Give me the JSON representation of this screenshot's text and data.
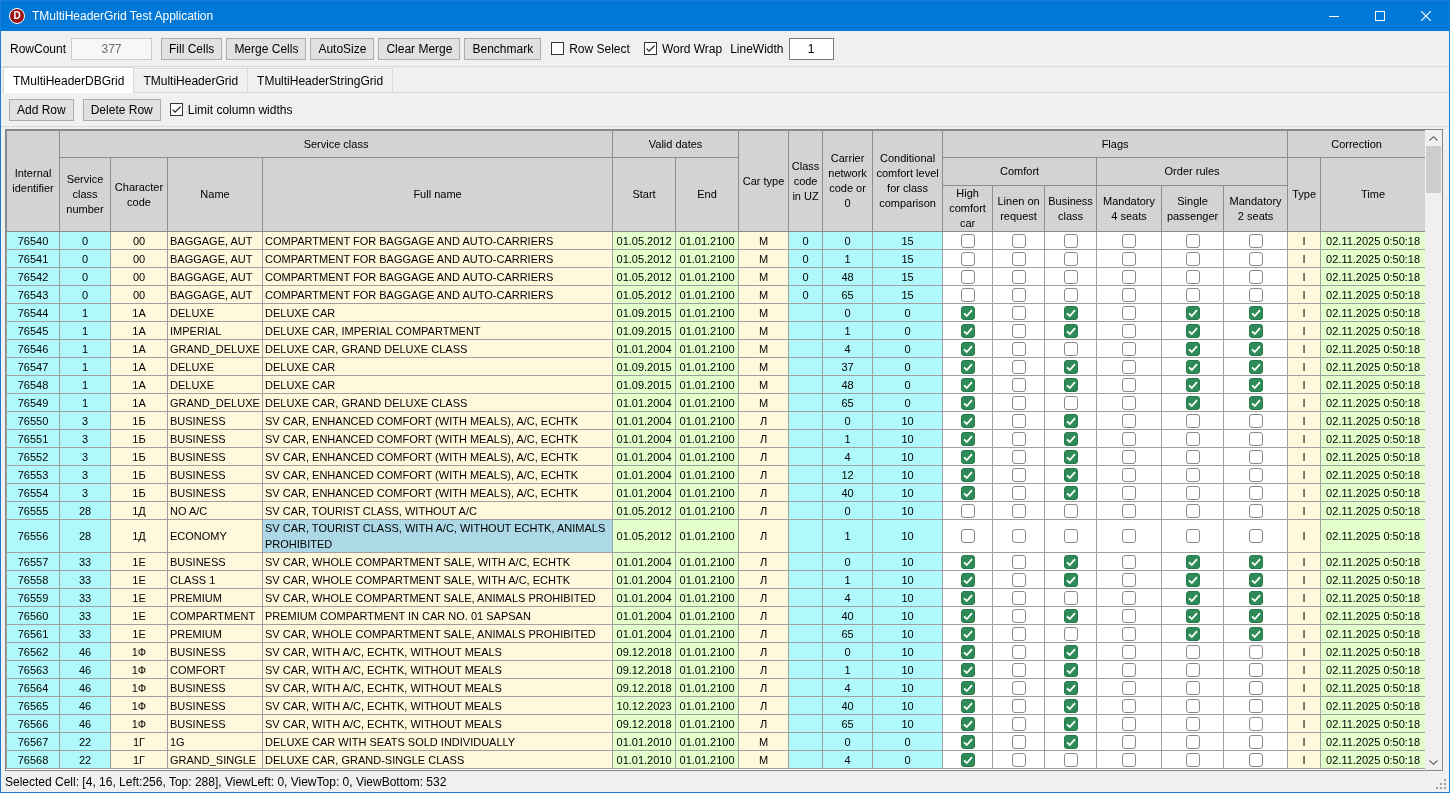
{
  "window": {
    "logo": "D",
    "title": "TMultiHeaderGrid Test Application"
  },
  "toolbar": {
    "row_count": {
      "label": "RowCount",
      "value": "377",
      "disabled": true
    },
    "buttons": [
      "Fill Cells",
      "Merge Cells",
      "AutoSize",
      "Clear Merge",
      "Benchmark"
    ],
    "checkboxes": [
      {
        "label": "Row Select",
        "checked": false
      },
      {
        "label": "Word Wrap",
        "checked": true
      }
    ],
    "line_width": {
      "label": "LineWidth",
      "value": "1"
    }
  },
  "tabs": [
    {
      "label": "TMultiHeaderDBGrid",
      "selected": true
    },
    {
      "label": "TMultiHeaderGrid",
      "selected": false
    },
    {
      "label": "TMultiHeaderStringGrid",
      "selected": false
    }
  ],
  "grid_toolbar": {
    "buttons": [
      "Add Row",
      "Delete Row"
    ],
    "checkbox": {
      "label": "Limit column widths",
      "checked": true
    }
  },
  "grid": {
    "header": [
      {
        "label": "Internal identifier",
        "kind": "number",
        "selected": false
      },
      {
        "label": "Service class",
        "children": [
          {
            "label": "Service class number",
            "kind": "number",
            "selected": false
          },
          {
            "label": "Character code",
            "kind": "code",
            "selected": false
          },
          {
            "label": "Name",
            "kind": "text",
            "selected": false
          },
          {
            "label": "Full name",
            "kind": "text",
            "selected": true
          }
        ]
      },
      {
        "label": "Valid dates",
        "children": [
          {
            "label": "Start",
            "kind": "date",
            "selected": false
          },
          {
            "label": "End",
            "kind": "date",
            "selected": false
          }
        ]
      },
      {
        "label": "Car type",
        "kind": "code",
        "selected": false
      },
      {
        "label": "Class code in UZ",
        "kind": "number",
        "selected": false
      },
      {
        "label": "Carrier network code or 0",
        "kind": "number",
        "selected": false
      },
      {
        "label": "Conditional comfort level for class comparison",
        "kind": "number",
        "selected": false
      },
      {
        "label": "Flags",
        "children": [
          {
            "label": "Comfort",
            "children": [
              {
                "label": "High comfort car",
                "kind": "flag",
                "selected": false
              },
              {
                "label": "Linen on request",
                "kind": "flag",
                "selected": false
              },
              {
                "label": "Business class",
                "kind": "flag",
                "selected": false
              }
            ]
          },
          {
            "label": "Order rules",
            "children": [
              {
                "label": "Mandatory 4 seats",
                "kind": "flag",
                "selected": false
              },
              {
                "label": "Single passenger",
                "kind": "flag",
                "selected": false
              },
              {
                "label": "Mandatory 2 seats",
                "kind": "flag",
                "selected": false
              }
            ]
          }
        ]
      },
      {
        "label": "Correction",
        "children": [
          {
            "label": "Type",
            "kind": "code",
            "selected": false
          },
          {
            "label": "Time",
            "kind": "date",
            "selected": false
          }
        ]
      }
    ],
    "rows": [
      {
        "selected": false,
        "cells": [
          "76540",
          "0",
          "00",
          "BAGGAGE, AUT",
          "COMPARTMENT FOR BAGGAGE AND AUTO-CARRIERS",
          "01.05.2012",
          "01.01.2100",
          "М",
          "0",
          "0",
          "15",
          "I",
          "02.11.2025 0:50:18"
        ],
        "checked": [
          false,
          false,
          false,
          false,
          false,
          false
        ]
      },
      {
        "selected": false,
        "cells": [
          "76541",
          "0",
          "00",
          "BAGGAGE, AUT",
          "COMPARTMENT FOR BAGGAGE AND AUTO-CARRIERS",
          "01.05.2012",
          "01.01.2100",
          "М",
          "0",
          "1",
          "15",
          "I",
          "02.11.2025 0:50:18"
        ],
        "checked": [
          false,
          false,
          false,
          false,
          false,
          false
        ]
      },
      {
        "selected": false,
        "cells": [
          "76542",
          "0",
          "00",
          "BAGGAGE, AUT",
          "COMPARTMENT FOR BAGGAGE AND AUTO-CARRIERS",
          "01.05.2012",
          "01.01.2100",
          "М",
          "0",
          "48",
          "15",
          "I",
          "02.11.2025 0:50:18"
        ],
        "checked": [
          false,
          false,
          false,
          false,
          false,
          false
        ]
      },
      {
        "selected": false,
        "cells": [
          "76543",
          "0",
          "00",
          "BAGGAGE, AUT",
          "COMPARTMENT FOR BAGGAGE AND AUTO-CARRIERS",
          "01.05.2012",
          "01.01.2100",
          "М",
          "0",
          "65",
          "15",
          "I",
          "02.11.2025 0:50:18"
        ],
        "checked": [
          false,
          false,
          false,
          false,
          false,
          false
        ]
      },
      {
        "selected": false,
        "cells": [
          "76544",
          "1",
          "1А",
          "DELUXE",
          "DELUXE CAR",
          "01.09.2015",
          "01.01.2100",
          "М",
          null,
          "0",
          "0",
          "I",
          "02.11.2025 0:50:18"
        ],
        "checked": [
          true,
          false,
          true,
          false,
          true,
          true
        ]
      },
      {
        "selected": false,
        "cells": [
          "76545",
          "1",
          "1А",
          "IMPERIAL",
          "DELUXE CAR, IMPERIAL COMPARTMENT",
          "01.09.2015",
          "01.01.2100",
          "М",
          null,
          "1",
          "0",
          "I",
          "02.11.2025 0:50:18"
        ],
        "checked": [
          true,
          false,
          true,
          false,
          true,
          true
        ]
      },
      {
        "selected": false,
        "cells": [
          "76546",
          "1",
          "1А",
          "GRAND_DELUXE",
          "DELUXE CAR, GRAND DELUXE CLASS",
          "01.01.2004",
          "01.01.2100",
          "М",
          null,
          "4",
          "0",
          "I",
          "02.11.2025 0:50:18"
        ],
        "checked": [
          true,
          false,
          false,
          false,
          true,
          true
        ]
      },
      {
        "selected": false,
        "cells": [
          "76547",
          "1",
          "1А",
          "DELUXE",
          "DELUXE CAR",
          "01.09.2015",
          "01.01.2100",
          "М",
          null,
          "37",
          "0",
          "I",
          "02.11.2025 0:50:18"
        ],
        "checked": [
          true,
          false,
          true,
          false,
          true,
          true
        ]
      },
      {
        "selected": false,
        "cells": [
          "76548",
          "1",
          "1А",
          "DELUXE",
          "DELUXE CAR",
          "01.09.2015",
          "01.01.2100",
          "М",
          null,
          "48",
          "0",
          "I",
          "02.11.2025 0:50:18"
        ],
        "checked": [
          true,
          false,
          true,
          false,
          true,
          true
        ]
      },
      {
        "selected": false,
        "cells": [
          "76549",
          "1",
          "1А",
          "GRAND_DELUXE",
          "DELUXE CAR, GRAND DELUXE CLASS",
          "01.01.2004",
          "01.01.2100",
          "М",
          null,
          "65",
          "0",
          "I",
          "02.11.2025 0:50:18"
        ],
        "checked": [
          true,
          false,
          false,
          false,
          true,
          true
        ]
      },
      {
        "selected": false,
        "cells": [
          "76550",
          "3",
          "1Б",
          "BUSINESS",
          "SV CAR, ENHANCED COMFORT (WITH MEALS), A/C, ECHTK",
          "01.01.2004",
          "01.01.2100",
          "Л",
          null,
          "0",
          "10",
          "I",
          "02.11.2025 0:50:18"
        ],
        "checked": [
          true,
          false,
          true,
          false,
          false,
          false
        ]
      },
      {
        "selected": false,
        "cells": [
          "76551",
          "3",
          "1Б",
          "BUSINESS",
          "SV CAR, ENHANCED COMFORT (WITH MEALS), A/C, ECHTK",
          "01.01.2004",
          "01.01.2100",
          "Л",
          null,
          "1",
          "10",
          "I",
          "02.11.2025 0:50:18"
        ],
        "checked": [
          true,
          false,
          true,
          false,
          false,
          false
        ]
      },
      {
        "selected": false,
        "cells": [
          "76552",
          "3",
          "1Б",
          "BUSINESS",
          "SV CAR, ENHANCED COMFORT (WITH MEALS), A/C, ECHTK",
          "01.01.2004",
          "01.01.2100",
          "Л",
          null,
          "4",
          "10",
          "I",
          "02.11.2025 0:50:18"
        ],
        "checked": [
          true,
          false,
          true,
          false,
          false,
          false
        ]
      },
      {
        "selected": false,
        "cells": [
          "76553",
          "3",
          "1Б",
          "BUSINESS",
          "SV CAR, ENHANCED COMFORT (WITH MEALS), A/C, ECHTK",
          "01.01.2004",
          "01.01.2100",
          "Л",
          null,
          "12",
          "10",
          "I",
          "02.11.2025 0:50:18"
        ],
        "checked": [
          true,
          false,
          true,
          false,
          false,
          false
        ]
      },
      {
        "selected": false,
        "cells": [
          "76554",
          "3",
          "1Б",
          "BUSINESS",
          "SV CAR, ENHANCED COMFORT (WITH MEALS), A/C, ECHTK",
          "01.01.2004",
          "01.01.2100",
          "Л",
          null,
          "40",
          "10",
          "I",
          "02.11.2025 0:50:18"
        ],
        "checked": [
          true,
          false,
          true,
          false,
          false,
          false
        ]
      },
      {
        "selected": false,
        "cells": [
          "76555",
          "28",
          "1Д",
          "NO A/C",
          "SV CAR, TOURIST CLASS, WITHOUT A/C",
          "01.05.2012",
          "01.01.2100",
          "Л",
          null,
          "0",
          "10",
          "I",
          "02.11.2025 0:50:18"
        ],
        "checked": [
          false,
          false,
          false,
          false,
          false,
          false
        ]
      },
      {
        "selected": true,
        "cells": [
          "76556",
          "28",
          "1Д",
          "ECONOMY",
          "SV CAR, TOURIST CLASS, WITH A/C, WITHOUT ECHTK, ANIMALS PROHIBITED",
          "01.05.2012",
          "01.01.2100",
          "Л",
          null,
          "1",
          "10",
          "I",
          "02.11.2025 0:50:18"
        ],
        "checked": [
          false,
          false,
          false,
          false,
          false,
          false
        ]
      },
      {
        "selected": false,
        "cells": [
          "76557",
          "33",
          "1Е",
          "BUSINESS",
          "SV CAR, WHOLE COMPARTMENT SALE, WITH A/C, ECHTK",
          "01.01.2004",
          "01.01.2100",
          "Л",
          null,
          "0",
          "10",
          "I",
          "02.11.2025 0:50:18"
        ],
        "checked": [
          true,
          false,
          true,
          false,
          true,
          true
        ]
      },
      {
        "selected": false,
        "cells": [
          "76558",
          "33",
          "1Е",
          "CLASS 1",
          "SV CAR, WHOLE COMPARTMENT SALE, WITH A/C, ECHTK",
          "01.01.2004",
          "01.01.2100",
          "Л",
          null,
          "1",
          "10",
          "I",
          "02.11.2025 0:50:18"
        ],
        "checked": [
          true,
          false,
          true,
          false,
          true,
          true
        ]
      },
      {
        "selected": false,
        "cells": [
          "76559",
          "33",
          "1Е",
          "PREMIUM",
          "SV CAR, WHOLE COMPARTMENT SALE, ANIMALS PROHIBITED",
          "01.01.2004",
          "01.01.2100",
          "Л",
          null,
          "4",
          "10",
          "I",
          "02.11.2025 0:50:18"
        ],
        "checked": [
          true,
          false,
          false,
          false,
          true,
          true
        ]
      },
      {
        "selected": false,
        "cells": [
          "76560",
          "33",
          "1Е",
          "COMPARTMENT",
          "PREMIUM COMPARTMENT IN CAR NO. 01 SAPSAN",
          "01.01.2004",
          "01.01.2100",
          "Л",
          null,
          "40",
          "10",
          "I",
          "02.11.2025 0:50:18"
        ],
        "checked": [
          true,
          false,
          true,
          false,
          true,
          true
        ]
      },
      {
        "selected": false,
        "cells": [
          "76561",
          "33",
          "1Е",
          "PREMIUM",
          "SV CAR, WHOLE COMPARTMENT SALE, ANIMALS PROHIBITED",
          "01.01.2004",
          "01.01.2100",
          "Л",
          null,
          "65",
          "10",
          "I",
          "02.11.2025 0:50:18"
        ],
        "checked": [
          true,
          false,
          false,
          false,
          true,
          true
        ]
      },
      {
        "selected": false,
        "cells": [
          "76562",
          "46",
          "1Ф",
          "BUSINESS",
          "SV CAR, WITH A/C, ECHTK, WITHOUT MEALS",
          "09.12.2018",
          "01.01.2100",
          "Л",
          null,
          "0",
          "10",
          "I",
          "02.11.2025 0:50:18"
        ],
        "checked": [
          true,
          false,
          true,
          false,
          false,
          false
        ]
      },
      {
        "selected": false,
        "cells": [
          "76563",
          "46",
          "1Ф",
          "COMFORT",
          "SV CAR, WITH A/C, ECHTK, WITHOUT MEALS",
          "09.12.2018",
          "01.01.2100",
          "Л",
          null,
          "1",
          "10",
          "I",
          "02.11.2025 0:50:18"
        ],
        "checked": [
          true,
          false,
          true,
          false,
          false,
          false
        ]
      },
      {
        "selected": false,
        "cells": [
          "76564",
          "46",
          "1Ф",
          "BUSINESS",
          "SV CAR, WITH A/C, ECHTK, WITHOUT MEALS",
          "09.12.2018",
          "01.01.2100",
          "Л",
          null,
          "4",
          "10",
          "I",
          "02.11.2025 0:50:18"
        ],
        "checked": [
          true,
          false,
          true,
          false,
          false,
          false
        ]
      },
      {
        "selected": false,
        "cells": [
          "76565",
          "46",
          "1Ф",
          "BUSINESS",
          "SV CAR, WITH A/C, ECHTK, WITHOUT MEALS",
          "10.12.2023",
          "01.01.2100",
          "Л",
          null,
          "40",
          "10",
          "I",
          "02.11.2025 0:50:18"
        ],
        "checked": [
          true,
          false,
          true,
          false,
          false,
          false
        ]
      },
      {
        "selected": false,
        "cells": [
          "76566",
          "46",
          "1Ф",
          "BUSINESS",
          "SV CAR, WITH A/C, ECHTK, WITHOUT MEALS",
          "09.12.2018",
          "01.01.2100",
          "Л",
          null,
          "65",
          "10",
          "I",
          "02.11.2025 0:50:18"
        ],
        "checked": [
          true,
          false,
          true,
          false,
          false,
          false
        ]
      },
      {
        "selected": false,
        "cells": [
          "76567",
          "22",
          "1Г",
          "1G",
          "DELUXE CAR WITH SEATS SOLD INDIVIDUALLY",
          "01.01.2010",
          "01.01.2100",
          "М",
          null,
          "0",
          "0",
          "I",
          "02.11.2025 0:50:18"
        ],
        "checked": [
          true,
          false,
          true,
          false,
          false,
          false
        ]
      },
      {
        "selected": false,
        "cells": [
          "76568",
          "22",
          "1Г",
          "GRAND_SINGLE",
          "DELUXE CAR, GRAND-SINGLE CLASS",
          "01.01.2010",
          "01.01.2100",
          "М",
          null,
          "4",
          "0",
          "I",
          "02.11.2025 0:50:18"
        ],
        "checked": [
          true,
          false,
          false,
          false,
          false,
          false
        ]
      }
    ]
  },
  "status_bar": "Selected Cell: [4, 16, Left:256, Top: 288], ViewLeft: 0, ViewTop: 0, ViewBottom: 532"
}
